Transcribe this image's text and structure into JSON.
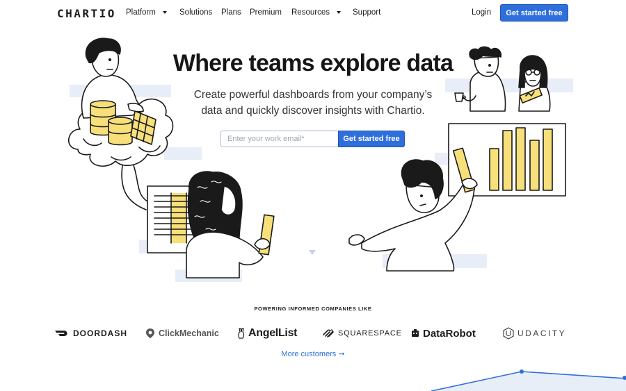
{
  "nav": {
    "logo": "CHARTIO",
    "items": [
      {
        "label": "Platform",
        "has_dropdown": true
      },
      {
        "label": "Solutions",
        "has_dropdown": false
      },
      {
        "label": "Plans",
        "has_dropdown": false
      },
      {
        "label": "Premium",
        "has_dropdown": false
      },
      {
        "label": "Resources",
        "has_dropdown": true
      },
      {
        "label": "Support",
        "has_dropdown": false
      }
    ],
    "login": "Login",
    "cta": "Get started free"
  },
  "hero": {
    "title": "Where teams explore data",
    "subtitle": "Create powerful dashboards from your company’s data and quickly discover insights with Chartio.",
    "email_placeholder": "Enter your work email*",
    "email_value": "",
    "cta": "Get started free"
  },
  "customers": {
    "heading": "POWERING INFORMED COMPANIES LIKE",
    "logos": [
      "DOORDASH",
      "ClickMechanic",
      "AngelList",
      "SQUARESPACE",
      "DataRobot",
      "UDACITY"
    ],
    "more_link": "More customers ➞"
  },
  "colors": {
    "accent": "#2f6fdb",
    "illustration_yellow": "#f7df7a",
    "illustration_panel": "#e8eef7"
  },
  "icons": [
    "caret-down-icon",
    "doordash-logo-icon",
    "clickmechanic-pin-icon",
    "angellist-hand-icon",
    "squarespace-logo-icon",
    "datarobot-logo-icon",
    "udacity-logo-icon",
    "arrow-right-icon"
  ]
}
